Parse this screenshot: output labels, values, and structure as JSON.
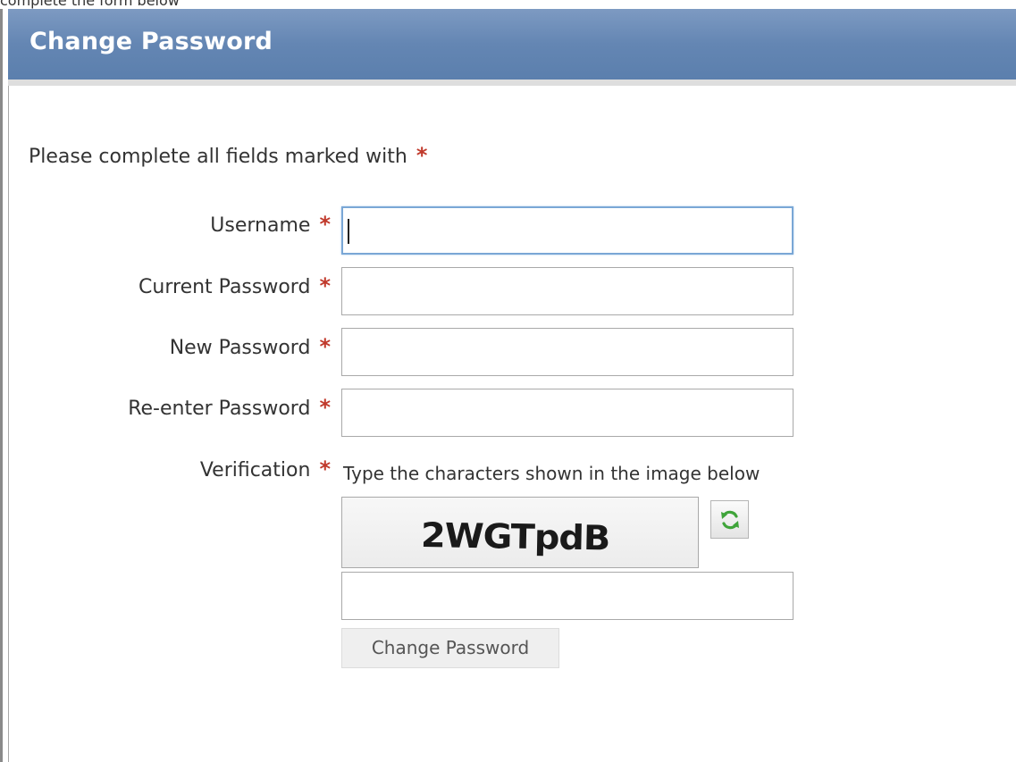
{
  "page_fragment": "complete the form below",
  "header": {
    "title": "Change Password"
  },
  "form": {
    "intro": "Please complete all fields marked with",
    "required_marker": "*",
    "fields": [
      {
        "label": "Username",
        "value": ""
      },
      {
        "label": "Current Password",
        "value": ""
      },
      {
        "label": "New Password",
        "value": ""
      },
      {
        "label": "Re-enter Password",
        "value": ""
      }
    ],
    "verification": {
      "label": "Verification",
      "hint": "Type the characters shown in the image below",
      "captcha_text": "2WGTpdB",
      "refresh_icon": "refresh-icon",
      "value": ""
    },
    "submit_label": "Change Password"
  },
  "colors": {
    "header_bg": "#6486b3",
    "required": "#c0392b",
    "focus_border": "#7aa7d6",
    "refresh_icon": "#3fa43a"
  }
}
